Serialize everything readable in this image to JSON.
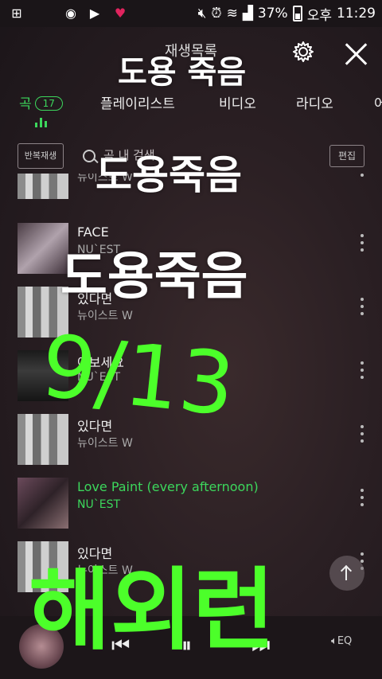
{
  "status_bar": {
    "battery": "37%",
    "ampm": "오후",
    "time": "11:29"
  },
  "header": {
    "title": "재생목록"
  },
  "tabs": [
    {
      "label": "곡",
      "badge": "17"
    },
    {
      "label": "플레이리스트"
    },
    {
      "label": "비디오"
    },
    {
      "label": "라디오"
    },
    {
      "label": "어"
    }
  ],
  "toolbar": {
    "repeat_label": "반복재생",
    "search_placeholder": "곡 내 검색",
    "edit_label": "편집"
  },
  "songs": [
    {
      "title": "",
      "artist": "뉴이스트 W"
    },
    {
      "title": "FACE",
      "artist": "NU`EST"
    },
    {
      "title": "있다면",
      "artist": "뉴이스트 W"
    },
    {
      "title": "여보세요",
      "artist": "NU`EST"
    },
    {
      "title": "있다면",
      "artist": "뉴이스트 W"
    },
    {
      "title": "Love Paint (every afternoon)",
      "artist": "NU`EST"
    },
    {
      "title": "있다면",
      "artist": "뉴이스트 W"
    }
  ],
  "player": {
    "eq_label": "EQ"
  },
  "overlay_text": {
    "line1": "도용 죽음",
    "line2": "도용죽음",
    "line3": "도용죽음",
    "date": "9/13",
    "bottom": "해외런"
  },
  "colors": {
    "accent": "#3cd75c",
    "handwriting": "#4cff2a"
  }
}
